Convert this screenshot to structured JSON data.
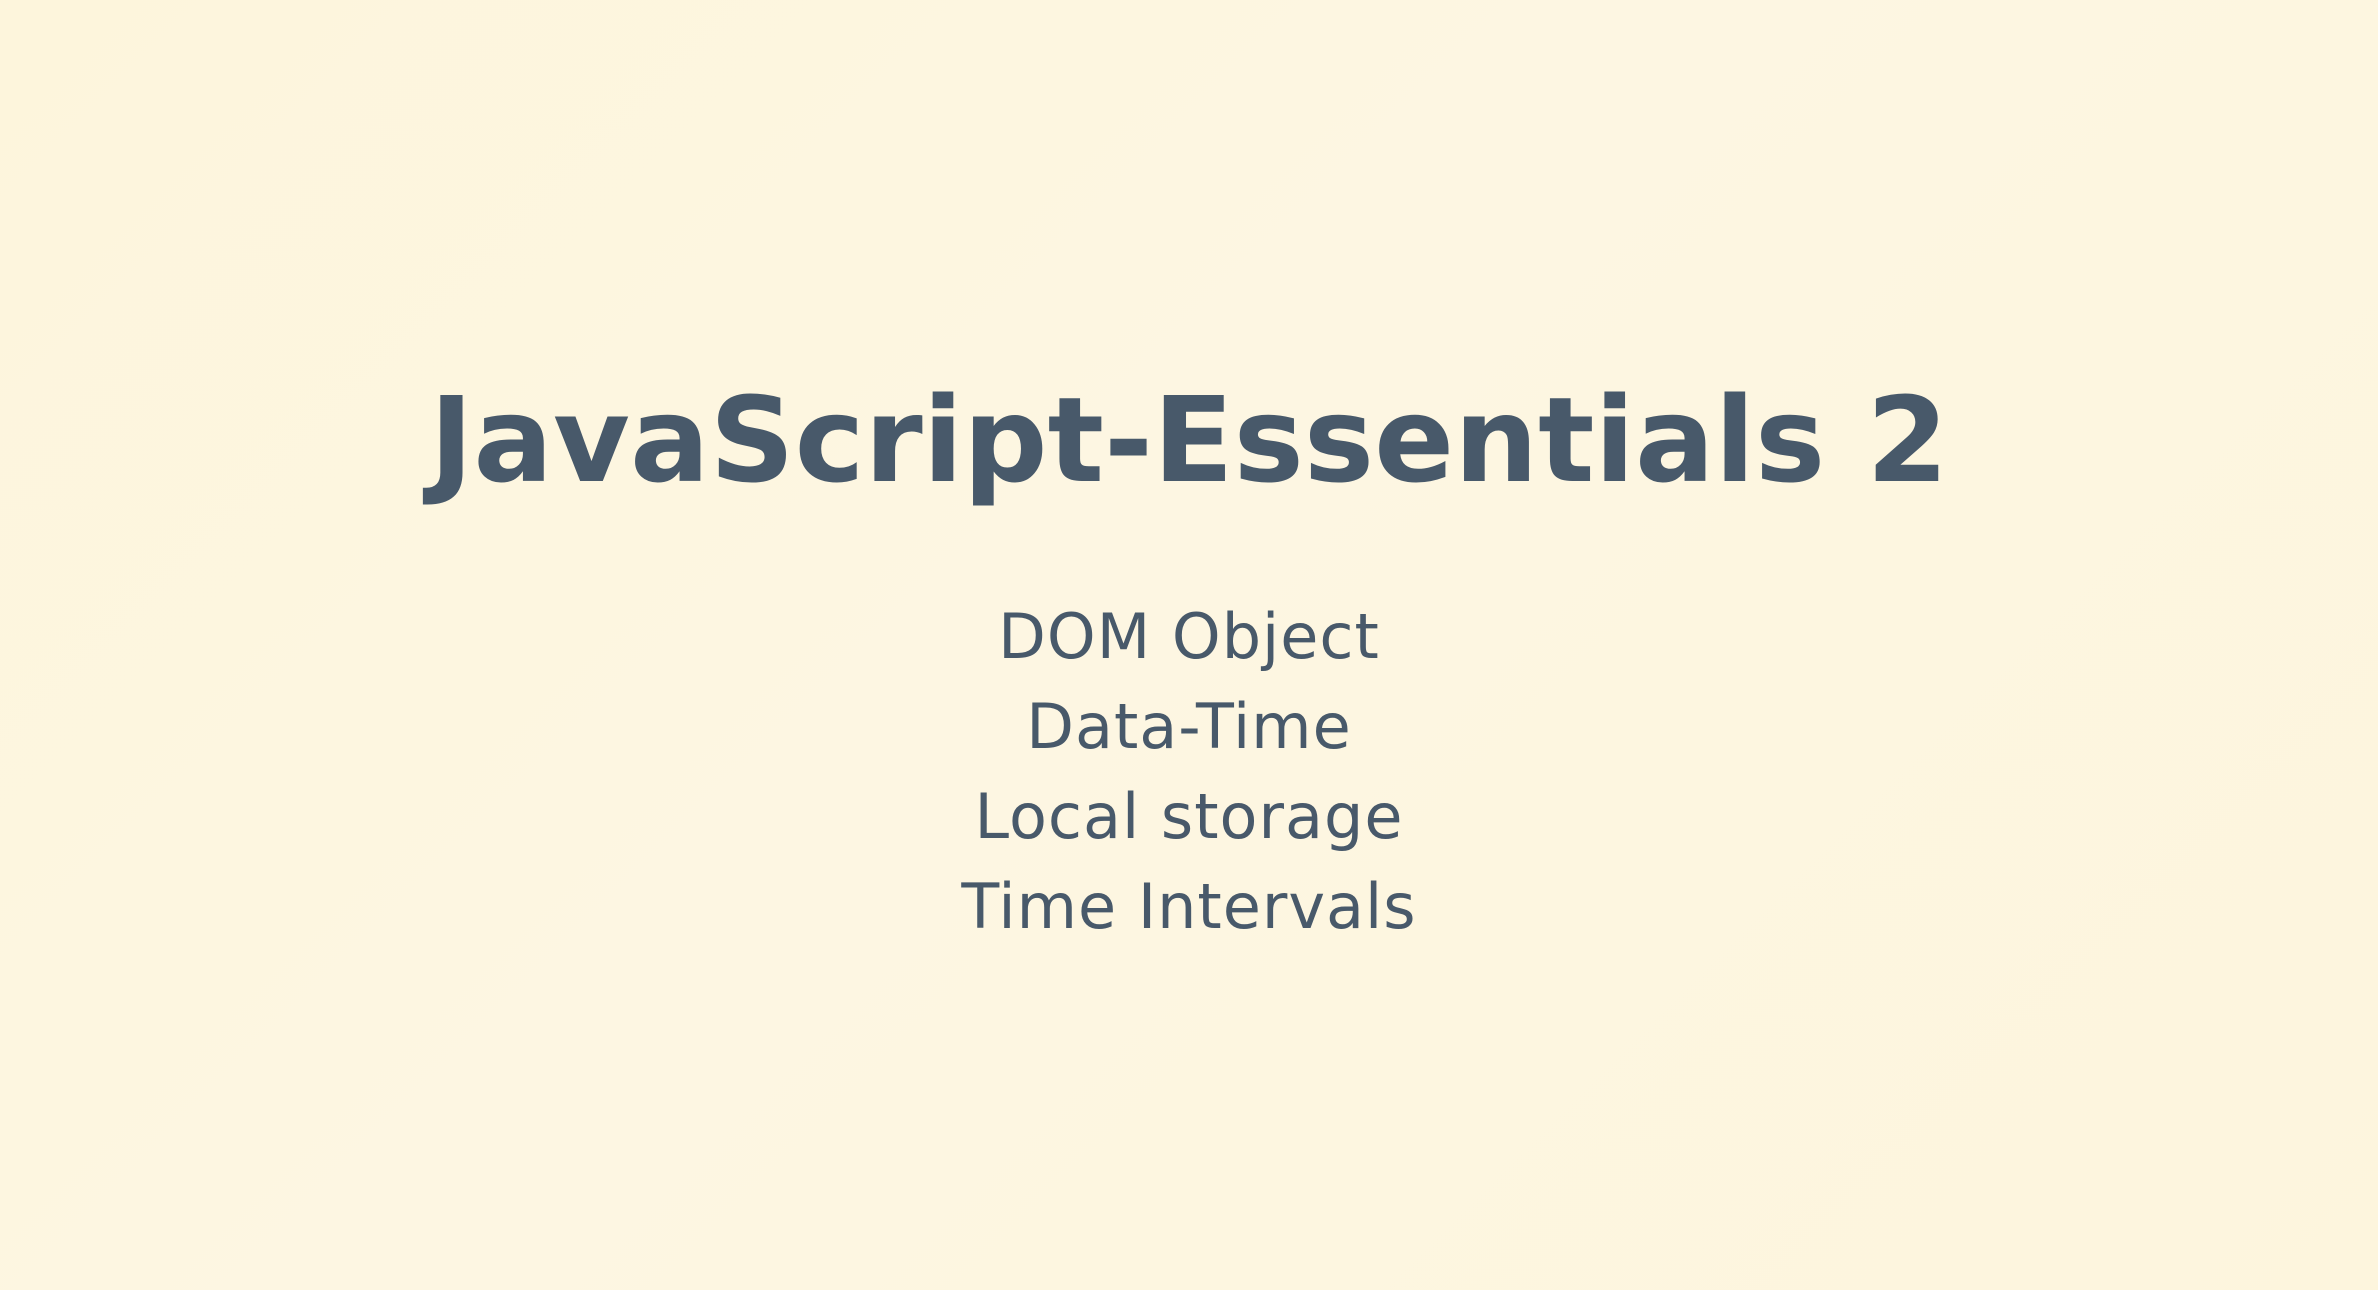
{
  "slide": {
    "title": "JavaScript-Essentials 2",
    "topics": [
      "DOM Object",
      "Data-Time",
      "Local storage",
      "Time Intervals"
    ]
  }
}
